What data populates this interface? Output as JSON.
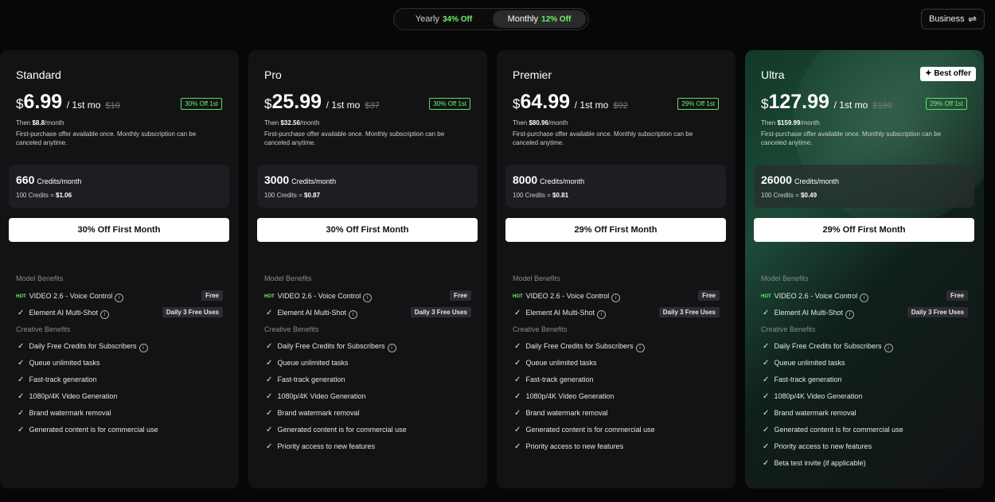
{
  "toggle": {
    "yearly": {
      "label": "Yearly",
      "pct": "34% Off"
    },
    "monthly": {
      "label": "Monthly",
      "pct": "12% Off"
    }
  },
  "business": {
    "label": "Business",
    "icon": "swap-arrows-icon"
  },
  "common": {
    "currency": "$",
    "per": "/ 1st mo",
    "then_prefix": "Then",
    "then_suffix": "/month",
    "desc": "First-purchase offer available once. Monthly subscription can be canceled anytime.",
    "credits_unit": "Credits/month",
    "credits_rate_prefix": "100 Credits =",
    "model_benefits": "Model Benefits",
    "creative_benefits": "Creative Benefits",
    "hot": "HOT",
    "info_glyph": "i",
    "check_glyph": "✓"
  },
  "plans": [
    {
      "name": "Standard",
      "price": "6.99",
      "old": "$10",
      "badge": "30% Off 1st",
      "then": "$8.8",
      "credits": "660",
      "rate": "$1.06",
      "cta": "30% Off First Month",
      "model": [
        {
          "label": "VIDEO 2.6 - Voice Control",
          "hot": true,
          "info": true,
          "tag": "Free"
        },
        {
          "label": "Element AI Multi-Shot",
          "hot": false,
          "info": true,
          "tag": "Daily 3 Free Uses"
        }
      ],
      "creative": [
        {
          "label": "Daily Free Credits for Subscribers",
          "info": true
        },
        {
          "label": "Queue unlimited tasks",
          "info": false
        },
        {
          "label": "Fast-track generation",
          "info": false
        },
        {
          "label": "1080p/4K Video Generation",
          "info": false
        },
        {
          "label": "Brand watermark removal",
          "info": false
        },
        {
          "label": "Generated content is for commercial use",
          "info": false
        }
      ]
    },
    {
      "name": "Pro",
      "price": "25.99",
      "old": "$37",
      "badge": "30% Off 1st",
      "then": "$32.56",
      "credits": "3000",
      "rate": "$0.87",
      "cta": "30% Off First Month",
      "model": [
        {
          "label": "VIDEO 2.6 - Voice Control",
          "hot": true,
          "info": true,
          "tag": "Free"
        },
        {
          "label": "Element AI Multi-Shot",
          "hot": false,
          "info": true,
          "tag": "Daily 3 Free Uses"
        }
      ],
      "creative": [
        {
          "label": "Daily Free Credits for Subscribers",
          "info": true
        },
        {
          "label": "Queue unlimited tasks",
          "info": false
        },
        {
          "label": "Fast-track generation",
          "info": false
        },
        {
          "label": "1080p/4K Video Generation",
          "info": false
        },
        {
          "label": "Brand watermark removal",
          "info": false
        },
        {
          "label": "Generated content is for commercial use",
          "info": false
        },
        {
          "label": "Priority access to new features",
          "info": false
        }
      ]
    },
    {
      "name": "Premier",
      "price": "64.99",
      "old": "$92",
      "badge": "29% Off 1st",
      "then": "$80.96",
      "credits": "8000",
      "rate": "$0.81",
      "cta": "29% Off First Month",
      "model": [
        {
          "label": "VIDEO 2.6 - Voice Control",
          "hot": true,
          "info": true,
          "tag": "Free"
        },
        {
          "label": "Element AI Multi-Shot",
          "hot": false,
          "info": true,
          "tag": "Daily 3 Free Uses"
        }
      ],
      "creative": [
        {
          "label": "Daily Free Credits for Subscribers",
          "info": true
        },
        {
          "label": "Queue unlimited tasks",
          "info": false
        },
        {
          "label": "Fast-track generation",
          "info": false
        },
        {
          "label": "1080p/4K Video Generation",
          "info": false
        },
        {
          "label": "Brand watermark removal",
          "info": false
        },
        {
          "label": "Generated content is for commercial use",
          "info": false
        },
        {
          "label": "Priority access to new features",
          "info": false
        }
      ]
    },
    {
      "name": "Ultra",
      "price": "127.99",
      "old": "$180",
      "badge": "29% Off 1st",
      "then": "$159.99",
      "credits": "26000",
      "rate": "$0.49",
      "cta": "29% Off First Month",
      "best": "Best offer",
      "model": [
        {
          "label": "VIDEO 2.6 - Voice Control",
          "hot": true,
          "info": true,
          "tag": "Free"
        },
        {
          "label": "Element AI Multi-Shot",
          "hot": false,
          "info": true,
          "tag": "Daily 3 Free Uses"
        }
      ],
      "creative": [
        {
          "label": "Daily Free Credits for Subscribers",
          "info": true
        },
        {
          "label": "Queue unlimited tasks",
          "info": false
        },
        {
          "label": "Fast-track generation",
          "info": false
        },
        {
          "label": "1080p/4K Video Generation",
          "info": false
        },
        {
          "label": "Brand watermark removal",
          "info": false
        },
        {
          "label": "Generated content is for commercial use",
          "info": false
        },
        {
          "label": "Priority access to new features",
          "info": false
        },
        {
          "label": "Beta test invite (if applicable)",
          "info": false
        }
      ]
    }
  ],
  "colors": {
    "accent_green": "#6cf36c",
    "background": "#070707",
    "card": "#131316"
  }
}
